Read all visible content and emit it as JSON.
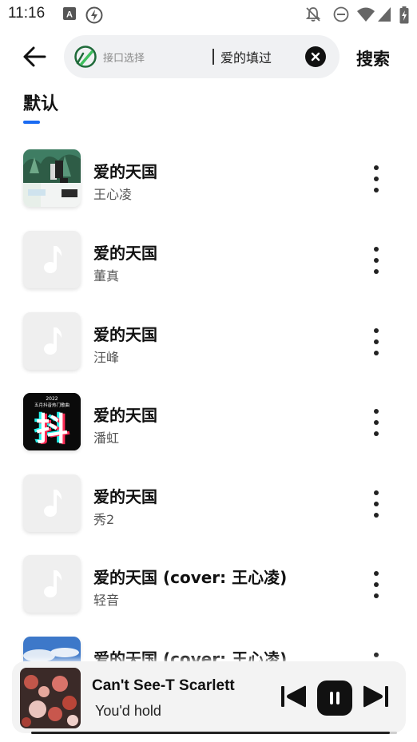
{
  "status_bar": {
    "time": "11:16",
    "icons": [
      "a-notification-icon",
      "flash-icon",
      "bell-off-icon",
      "do-not-disturb-icon",
      "wifi-icon",
      "signal-icon",
      "battery-charging-icon"
    ]
  },
  "header": {
    "back_icon": "arrow-left-icon",
    "search": {
      "source_label": "接口选择",
      "query": "爱的填过",
      "clear_icon": "close-circle-icon"
    },
    "search_action": "搜索"
  },
  "tabs": [
    {
      "label": "默认",
      "active": true
    }
  ],
  "songs": [
    {
      "title": "爱的天国",
      "artist": "王心凌",
      "cover": "photo-cover"
    },
    {
      "title": "爱的天国",
      "artist": "董真",
      "cover": "placeholder"
    },
    {
      "title": "爱的天国",
      "artist": "汪峰",
      "cover": "placeholder"
    },
    {
      "title": "爱的天国",
      "artist": "潘虹",
      "cover": "douyin-cover",
      "cover_text": {
        "year": "2022",
        "subtitle": "五月抖音热门歌曲",
        "glyph": "抖"
      }
    },
    {
      "title": "爱的天国",
      "artist": "秀2",
      "cover": "placeholder"
    },
    {
      "title": "爱的天国 (cover: 王心凌)",
      "artist": "轻音",
      "cover": "placeholder"
    },
    {
      "title": "爱的天国 (cover: 王心凌)",
      "artist": "",
      "cover": "sky-cover"
    }
  ],
  "player": {
    "title": "Can't See-T Scarlett",
    "subtitle": "You'd hold",
    "progress": 0.98,
    "icons": [
      "skip-previous-icon",
      "pause-icon",
      "skip-next-icon"
    ]
  },
  "colors": {
    "accent": "#1a6bf2",
    "search_bg": "#f0f1f3",
    "player_bg": "#f3f3f3",
    "placeholder_bg": "#efefef"
  }
}
